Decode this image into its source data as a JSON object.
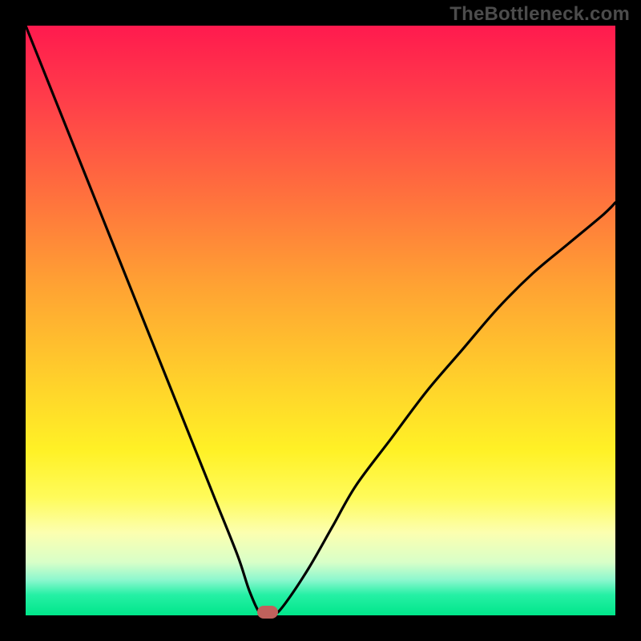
{
  "watermark": "TheBottleneck.com",
  "chart_data": {
    "type": "line",
    "title": "",
    "xlabel": "",
    "ylabel": "",
    "xlim": [
      0,
      100
    ],
    "ylim": [
      0,
      100
    ],
    "grid": false,
    "legend": false,
    "background_gradient": {
      "direction": "vertical",
      "stops": [
        {
          "pos": 0,
          "color": "#ff1a4e"
        },
        {
          "pos": 50,
          "color": "#ffc22c"
        },
        {
          "pos": 80,
          "color": "#fffb5a"
        },
        {
          "pos": 100,
          "color": "#00e68a"
        }
      ]
    },
    "series": [
      {
        "name": "bottleneck-curve",
        "x": [
          0,
          4,
          8,
          12,
          16,
          20,
          24,
          28,
          32,
          36,
          38,
          40,
          42,
          44,
          48,
          52,
          56,
          62,
          68,
          74,
          80,
          86,
          92,
          98,
          100
        ],
        "values": [
          100,
          90,
          80,
          70,
          60,
          50,
          40,
          30,
          20,
          10,
          4,
          0,
          0,
          2,
          8,
          15,
          22,
          30,
          38,
          45,
          52,
          58,
          63,
          68,
          70
        ]
      }
    ],
    "marker": {
      "x": 41,
      "y": 0,
      "color": "#c0615c"
    },
    "annotations": []
  }
}
